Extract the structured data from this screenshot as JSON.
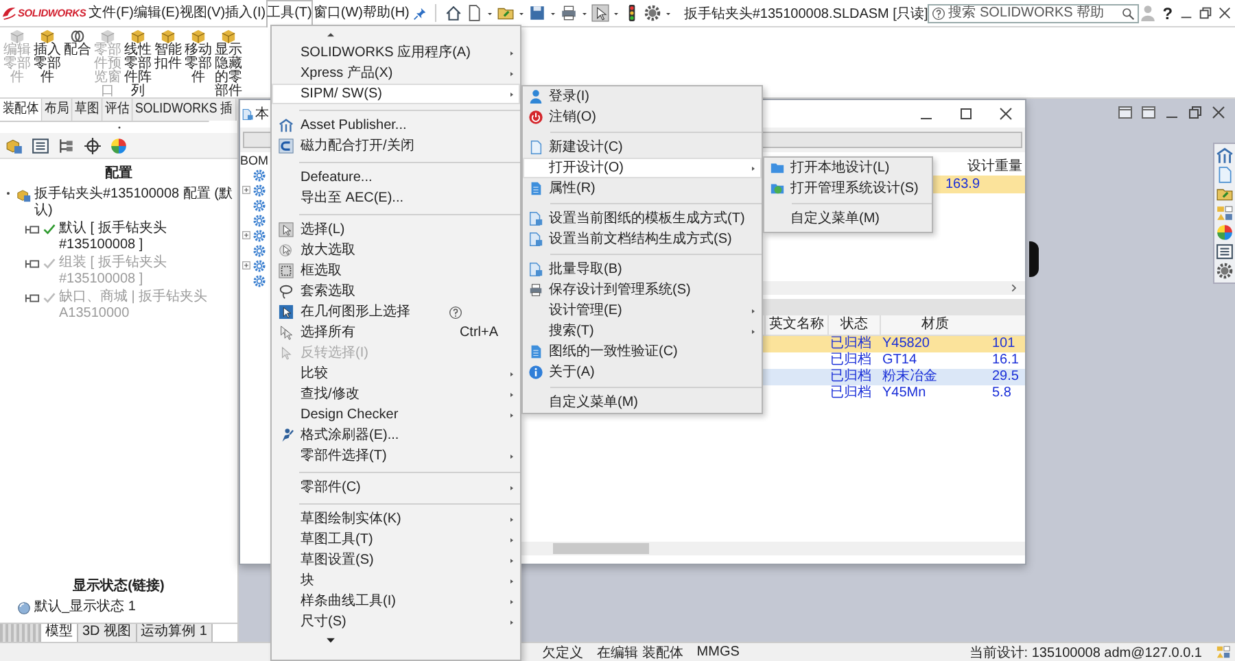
{
  "menubar": {
    "logo": "SOLIDWORKS",
    "items": [
      {
        "label": "文件(F)",
        "selected": false
      },
      {
        "label": "编辑(E)",
        "selected": false
      },
      {
        "label": "视图(V)",
        "selected": false
      },
      {
        "label": "插入(I)",
        "selected": false
      },
      {
        "label": "工具(T)",
        "selected": true
      },
      {
        "label": "窗口(W)",
        "selected": false
      },
      {
        "label": "帮助(H)",
        "selected": false
      }
    ]
  },
  "title": "扳手钻夹头#135100008.SLDASM [只读]",
  "search": {
    "placeholder": "搜索 SOLIDWORKS 帮助"
  },
  "help_button": "?",
  "ribbon": [
    {
      "label": "编辑零部件",
      "disabled": true
    },
    {
      "label": "插入零部件",
      "disabled": false
    },
    {
      "label": "配合",
      "disabled": false
    },
    {
      "label": "零部件预览窗口",
      "disabled": true
    },
    {
      "label": "线性零部件阵列",
      "disabled": false
    },
    {
      "label": "智能扣件",
      "disabled": false
    },
    {
      "label": "移动零部件",
      "disabled": false
    },
    {
      "label": "显示隐藏的零部件",
      "disabled": false
    }
  ],
  "tabs": [
    {
      "label": "装配体",
      "selected": true
    },
    {
      "label": "布局",
      "selected": false
    },
    {
      "label": "草图",
      "selected": false
    },
    {
      "label": "评估",
      "selected": false
    },
    {
      "label": "SOLIDWORKS 插",
      "selected": false
    }
  ],
  "config_panel": {
    "heading": "配置",
    "tree": [
      {
        "label": "扳手钻夹头#135100008 配置 (默认)",
        "children": [
          {
            "label": "默认 [ 扳手钻夹头#135100008 ]",
            "active": true
          },
          {
            "label": "组装 [ 扳手钻夹头#135100008 ]",
            "active": false
          },
          {
            "label": "缺口、商城 | 扳手钻夹头A13510000",
            "active": false
          }
        ]
      }
    ],
    "display_heading": "显示状态(链接)",
    "display_states": [
      "默认_显示状态 1"
    ]
  },
  "bottom_tabs": [
    {
      "label": "模型",
      "selected": true
    },
    {
      "label": "3D 视图",
      "selected": false
    },
    {
      "label": "运动算例 1",
      "selected": false
    }
  ],
  "dialog": {
    "title": "本",
    "tree_label": "BOM",
    "top_table": {
      "columns": [
        "设计重量"
      ],
      "rows": [
        {
          "weight": "163.9",
          "selected": true
        }
      ]
    },
    "bottom_table": {
      "columns": [
        "英文名称",
        "状态",
        "材质"
      ],
      "rows": [
        {
          "status": "已归档",
          "material": "Y45820",
          "weight": "101",
          "selected": true,
          "highlighted": false
        },
        {
          "status": "已归档",
          "material": "GT14",
          "weight": "16.1",
          "selected": false,
          "highlighted": false
        },
        {
          "status": "已归档",
          "material": "粉末冶金",
          "weight": "29.5",
          "selected": false,
          "highlighted": true
        },
        {
          "status": "已归档",
          "material": "Y45Mn",
          "weight": "5.8",
          "selected": false,
          "highlighted": false
        }
      ]
    }
  },
  "tools_menu": [
    {
      "kind": "item",
      "label": "SOLIDWORKS 应用程序(A)",
      "submenu": true,
      "selected": false,
      "disabled": false
    },
    {
      "kind": "item",
      "label": "Xpress 产品(X)",
      "submenu": true,
      "selected": false,
      "disabled": false
    },
    {
      "kind": "item",
      "label": "SIPM/ SW(S)",
      "submenu": true,
      "selected": true,
      "disabled": false
    },
    {
      "kind": "separator"
    },
    {
      "kind": "item",
      "label": "Asset Publisher...",
      "submenu": false,
      "selected": false,
      "disabled": false
    },
    {
      "kind": "item",
      "label": "磁力配合打开/关闭",
      "submenu": false,
      "selected": false,
      "disabled": false
    },
    {
      "kind": "separator"
    },
    {
      "kind": "item",
      "label": "Defeature...",
      "submenu": false,
      "selected": false,
      "disabled": false
    },
    {
      "kind": "item",
      "label": "导出至 AEC(E)...",
      "submenu": false,
      "selected": false,
      "disabled": false
    },
    {
      "kind": "separator"
    },
    {
      "kind": "item",
      "label": "选择(L)",
      "submenu": false,
      "selected": false,
      "disabled": false
    },
    {
      "kind": "item",
      "label": "放大选取",
      "submenu": false,
      "selected": false,
      "disabled": false
    },
    {
      "kind": "item",
      "label": "框选取",
      "submenu": false,
      "selected": false,
      "disabled": false
    },
    {
      "kind": "item",
      "label": "套索选取",
      "submenu": false,
      "selected": false,
      "disabled": false
    },
    {
      "kind": "item",
      "label": "在几何图形上选择",
      "submenu": false,
      "selected": false,
      "disabled": false
    },
    {
      "kind": "item",
      "label": "选择所有",
      "shortcut": "Ctrl+A",
      "submenu": false,
      "selected": false,
      "disabled": false
    },
    {
      "kind": "item",
      "label": "反转选择(I)",
      "submenu": false,
      "selected": false,
      "disabled": true
    },
    {
      "kind": "item",
      "label": "比较",
      "submenu": true,
      "selected": false,
      "disabled": false
    },
    {
      "kind": "item",
      "label": "查找/修改",
      "submenu": true,
      "selected": false,
      "disabled": false
    },
    {
      "kind": "item",
      "label": "Design Checker",
      "submenu": true,
      "selected": false,
      "disabled": false
    },
    {
      "kind": "item",
      "label": "格式涂刷器(E)...",
      "submenu": false,
      "selected": false,
      "disabled": false
    },
    {
      "kind": "item",
      "label": "零部件选择(T)",
      "submenu": true,
      "selected": false,
      "disabled": false
    },
    {
      "kind": "separator"
    },
    {
      "kind": "item",
      "label": "零部件(C)",
      "submenu": true,
      "selected": false,
      "disabled": false
    },
    {
      "kind": "separator"
    },
    {
      "kind": "item",
      "label": "草图绘制实体(K)",
      "submenu": true,
      "selected": false,
      "disabled": false
    },
    {
      "kind": "item",
      "label": "草图工具(T)",
      "submenu": true,
      "selected": false,
      "disabled": false
    },
    {
      "kind": "item",
      "label": "草图设置(S)",
      "submenu": true,
      "selected": false,
      "disabled": false
    },
    {
      "kind": "item",
      "label": "块",
      "submenu": true,
      "selected": false,
      "disabled": false
    },
    {
      "kind": "item",
      "label": "样条曲线工具(I)",
      "submenu": true,
      "selected": false,
      "disabled": false
    },
    {
      "kind": "item",
      "label": "尺寸(S)",
      "submenu": true,
      "selected": false,
      "disabled": false
    }
  ],
  "sipm_menu": [
    {
      "kind": "item",
      "label": "登录(I)",
      "submenu": false,
      "selected": false
    },
    {
      "kind": "item",
      "label": "注销(O)",
      "submenu": false,
      "selected": false
    },
    {
      "kind": "separator"
    },
    {
      "kind": "item",
      "label": "新建设计(C)",
      "submenu": false,
      "selected": false
    },
    {
      "kind": "item",
      "label": "打开设计(O)",
      "submenu": true,
      "selected": true
    },
    {
      "kind": "item",
      "label": "属性(R)",
      "submenu": false,
      "selected": false
    },
    {
      "kind": "separator"
    },
    {
      "kind": "item",
      "label": "设置当前图纸的模板生成方式(T)",
      "submenu": false,
      "selected": false
    },
    {
      "kind": "item",
      "label": "设置当前文档结构生成方式(S)",
      "submenu": false,
      "selected": false
    },
    {
      "kind": "separator"
    },
    {
      "kind": "item",
      "label": "批量导取(B)",
      "submenu": false,
      "selected": false
    },
    {
      "kind": "item",
      "label": "保存设计到管理系统(S)",
      "submenu": false,
      "selected": false
    },
    {
      "kind": "item",
      "label": "设计管理(E)",
      "submenu": true,
      "selected": false
    },
    {
      "kind": "item",
      "label": "搜索(T)",
      "submenu": true,
      "selected": false
    },
    {
      "kind": "item",
      "label": "图纸的一致性验证(C)",
      "submenu": false,
      "selected": false
    },
    {
      "kind": "item",
      "label": "关于(A)",
      "submenu": false,
      "selected": false
    },
    {
      "kind": "separator"
    },
    {
      "kind": "item",
      "label": "自定义菜单(M)",
      "submenu": false,
      "selected": false
    }
  ],
  "open_menu": [
    {
      "kind": "item",
      "label": "打开本地设计(L)",
      "selected": false
    },
    {
      "kind": "item",
      "label": "打开管理系统设计(S)",
      "selected": false
    },
    {
      "kind": "separator"
    },
    {
      "kind": "item",
      "label": "自定义菜单(M)",
      "selected": false
    }
  ],
  "status_bar": {
    "items": [
      "欠定义",
      "在编辑 装配体",
      "MMGS"
    ],
    "current": "当前设计: 135100008 adm@127.0.0.1"
  }
}
